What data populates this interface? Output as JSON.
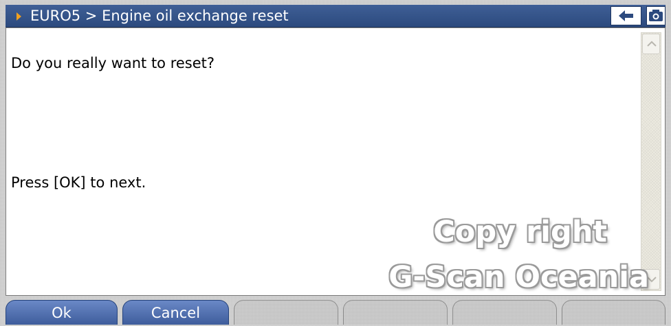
{
  "header": {
    "breadcrumb": "EURO5 > Engine oil exchange reset",
    "back_icon": "back-arrow-icon",
    "snapshot_icon": "camera-icon"
  },
  "dialog": {
    "question": "Do you really want to reset?",
    "instruction": "Press [OK] to next."
  },
  "watermark": {
    "line1": "Copy right",
    "line2": "G-Scan Oceania"
  },
  "footer": {
    "buttons": [
      {
        "label": "Ok",
        "enabled": true
      },
      {
        "label": "Cancel",
        "enabled": true
      },
      {
        "label": "",
        "enabled": false
      },
      {
        "label": "",
        "enabled": false
      },
      {
        "label": "",
        "enabled": false
      },
      {
        "label": "",
        "enabled": false
      }
    ]
  },
  "colors": {
    "title_bar": "#2f4e84",
    "active_button": "#4f6fb0",
    "accent_arrow": "#f2a01f"
  }
}
